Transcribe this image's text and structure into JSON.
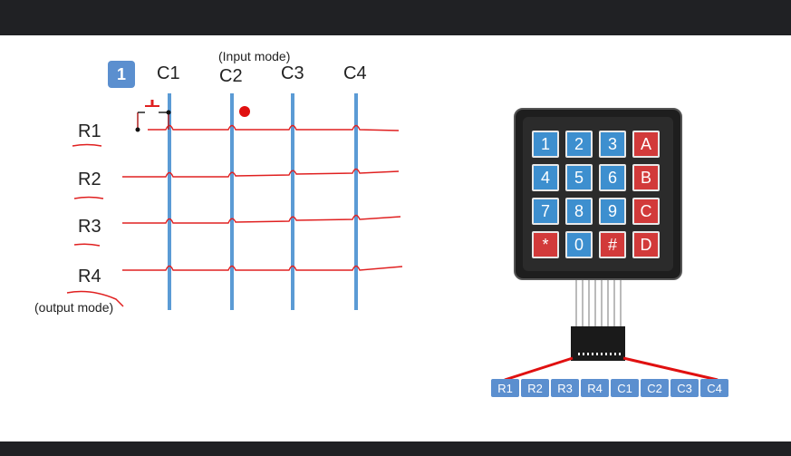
{
  "badge": "1",
  "input_mode_label": "(Input mode)",
  "output_mode_label": "(output mode)",
  "columns": [
    "C1",
    "C2",
    "C3",
    "C4"
  ],
  "rows": [
    "R1",
    "R2",
    "R3",
    "R4"
  ],
  "keypad": {
    "keys": [
      [
        "1",
        "2",
        "3",
        "A"
      ],
      [
        "4",
        "5",
        "6",
        "B"
      ],
      [
        "7",
        "8",
        "9",
        "C"
      ],
      [
        "*",
        "0",
        "#",
        "D"
      ]
    ],
    "colors": {
      "numeric": "#3d8fcf",
      "letter": "#d23a3a",
      "star": "#d23a3a",
      "hash": "#d23a3a"
    }
  },
  "connector_pins": [
    "R1",
    "R2",
    "R3",
    "R4",
    "C1",
    "C2",
    "C3",
    "C4"
  ],
  "colors": {
    "wire": "#e02020",
    "column_line": "#5b9bd5",
    "pin": "#5b8fcf",
    "topbar": "#202124"
  }
}
